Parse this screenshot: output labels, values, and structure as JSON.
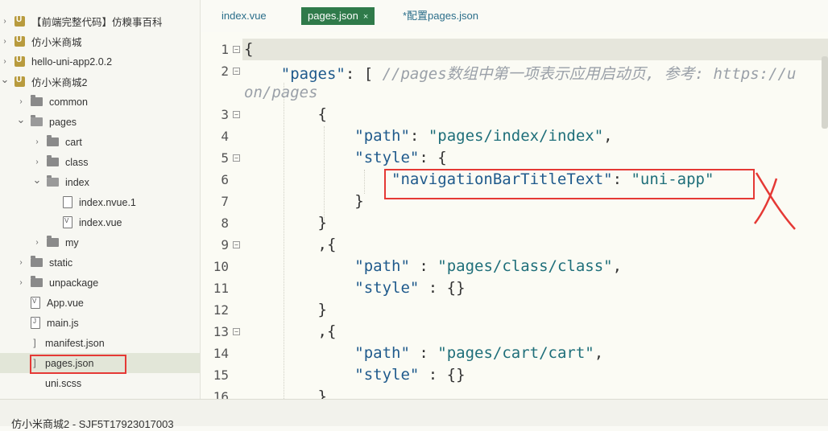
{
  "sidebar": {
    "items": [
      {
        "label": "【前端完整代码】仿糗事百科",
        "type": "project",
        "depth": 0,
        "expanded": false
      },
      {
        "label": "仿小米商城",
        "type": "project",
        "depth": 0,
        "expanded": false
      },
      {
        "label": "hello-uni-app2.0.2",
        "type": "project",
        "depth": 0,
        "expanded": false
      },
      {
        "label": "仿小米商城2",
        "type": "project",
        "depth": 0,
        "expanded": true
      },
      {
        "label": "common",
        "type": "folder",
        "depth": 1,
        "expanded": false
      },
      {
        "label": "pages",
        "type": "folder-open",
        "depth": 1,
        "expanded": true
      },
      {
        "label": "cart",
        "type": "folder",
        "depth": 2,
        "expanded": false
      },
      {
        "label": "class",
        "type": "folder",
        "depth": 2,
        "expanded": false
      },
      {
        "label": "index",
        "type": "folder-open",
        "depth": 2,
        "expanded": true
      },
      {
        "label": "index.nvue.1",
        "type": "file",
        "depth": 3
      },
      {
        "label": "index.vue",
        "type": "vue",
        "depth": 3
      },
      {
        "label": "my",
        "type": "folder",
        "depth": 2,
        "expanded": false
      },
      {
        "label": "static",
        "type": "folder",
        "depth": 1,
        "expanded": false
      },
      {
        "label": "unpackage",
        "type": "folder",
        "depth": 1,
        "expanded": false
      },
      {
        "label": "App.vue",
        "type": "vue",
        "depth": 1
      },
      {
        "label": "main.js",
        "type": "js",
        "depth": 1
      },
      {
        "label": "manifest.json",
        "type": "json",
        "depth": 1
      },
      {
        "label": "pages.json",
        "type": "json",
        "depth": 1,
        "selected": true
      },
      {
        "label": "uni.scss",
        "type": "scss",
        "depth": 1
      }
    ]
  },
  "tabs": [
    {
      "label": "index.vue",
      "active": false
    },
    {
      "label": "pages.json",
      "active": true,
      "close": "×"
    },
    {
      "label": "*配置pages.json",
      "active": false
    }
  ],
  "editor": {
    "line_numbers": [
      "1",
      "2",
      "",
      "3",
      "4",
      "5",
      "6",
      "7",
      "8",
      "9",
      "10",
      "11",
      "12",
      "13",
      "14",
      "15",
      "16"
    ],
    "lines": {
      "l1": "{",
      "l2_key": "\"pages\"",
      "l2_punct": ": [ ",
      "l2_comment": "//pages数组中第一项表示应用启动页, 参考: https://u",
      "l2_wrap": "on/pages",
      "l3": "{",
      "l4_key": "\"path\"",
      "l4_punct": ": ",
      "l4_val": "\"pages/index/index\"",
      "l4_end": ",",
      "l5_key": "\"style\"",
      "l5_punct": ": {",
      "l6_key": "\"navigationBarTitleText\"",
      "l6_punct": ": ",
      "l6_val": "\"uni-app\"",
      "l7": "}",
      "l8": "}",
      "l9": ",{",
      "l10_key": "\"path\"",
      "l10_punct": " : ",
      "l10_val": "\"pages/class/class\"",
      "l10_end": ",",
      "l11_key": "\"style\"",
      "l11_punct": " : {}",
      "l12": "}",
      "l13": ",{",
      "l14_key": "\"path\"",
      "l14_punct": " : ",
      "l14_val": "\"pages/cart/cart\"",
      "l14_end": ",",
      "l15_key": "\"style\"",
      "l15_punct": " : {}",
      "l16": "}"
    }
  },
  "status_bar": {
    "text": "仿小米商城2 - SJF5T17923017003"
  },
  "colors": {
    "active_tab": "#2f7a4a",
    "annotation_red": "#e53935"
  }
}
